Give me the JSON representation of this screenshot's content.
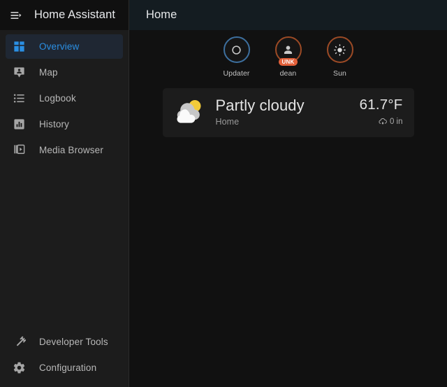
{
  "sidebar": {
    "menu_icon": "menu-open-icon",
    "title": "Home Assistant",
    "top_items": [
      {
        "label": "Overview",
        "icon": "view-dashboard-icon",
        "active": true
      },
      {
        "label": "Map",
        "icon": "map-marker-account-icon",
        "active": false
      },
      {
        "label": "Logbook",
        "icon": "format-list-bulleted-icon",
        "active": false
      },
      {
        "label": "History",
        "icon": "chart-box-icon",
        "active": false
      },
      {
        "label": "Media Browser",
        "icon": "play-box-multiple-icon",
        "active": false
      }
    ],
    "bottom_items": [
      {
        "label": "Developer Tools",
        "icon": "hammer-icon"
      },
      {
        "label": "Configuration",
        "icon": "cog-icon"
      }
    ]
  },
  "toolbar": {
    "title": "Home"
  },
  "badges": [
    {
      "label": "Updater",
      "icon": "circle-outline-icon",
      "ring_color": "#3d6f9e",
      "pill": null
    },
    {
      "label": "dean",
      "icon": "account-icon",
      "ring_color": "#9c4a25",
      "pill": "UNK"
    },
    {
      "label": "Sun",
      "icon": "sun-icon",
      "ring_color": "#9c4a25",
      "pill": null
    }
  ],
  "weather_card": {
    "icon": "partly-cloudy-icon",
    "state": "Partly cloudy",
    "name": "Home",
    "temperature": "61.7°F",
    "precipitation": "0 in",
    "precipitation_icon": "weather-rainy-icon"
  },
  "colors": {
    "accent": "#2b8fe3",
    "badge_pill": "#e2603a",
    "card_bg": "#1c1c1c",
    "sidebar_bg": "#1c1c1c",
    "content_bg": "#111111",
    "toolbar_bg": "#141c21"
  }
}
